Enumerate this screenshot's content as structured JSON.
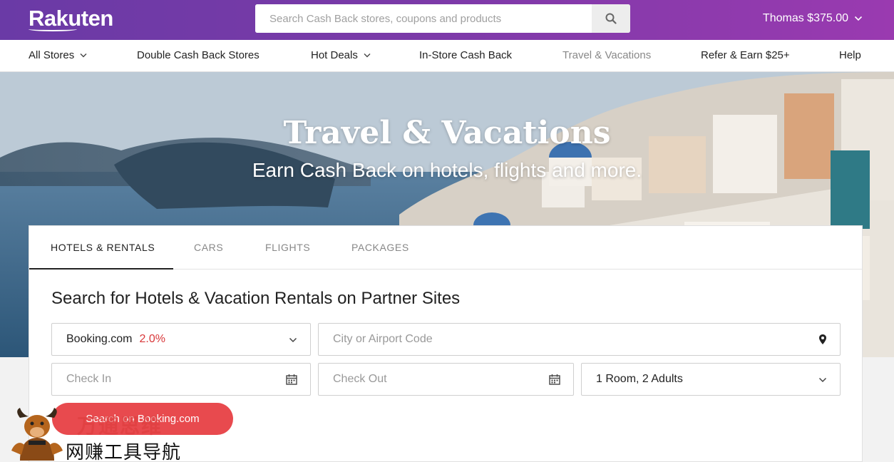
{
  "brand": {
    "logo_text": "Rakuten",
    "accent": "#7b3aa9",
    "cta_color": "#e84a4e",
    "rate_color": "#d9383a"
  },
  "header": {
    "search_placeholder": "Search Cash Back stores, coupons and products",
    "search_icon": "search-icon",
    "user_label": "Thomas $375.00"
  },
  "nav": {
    "items": [
      {
        "label": "All Stores",
        "has_dropdown": true
      },
      {
        "label": "Double Cash Back Stores",
        "has_dropdown": false
      },
      {
        "label": "Hot Deals",
        "has_dropdown": true
      },
      {
        "label": "In-Store Cash Back",
        "has_dropdown": false
      },
      {
        "label": "Travel & Vacations",
        "has_dropdown": false,
        "active": true
      },
      {
        "label": "Refer & Earn $25+",
        "has_dropdown": false
      },
      {
        "label": "Help",
        "has_dropdown": false
      }
    ]
  },
  "hero": {
    "title": "Travel & Vacations",
    "subtitle": "Earn Cash Back on hotels, flights and more."
  },
  "search_card": {
    "tabs": [
      {
        "label": "HOTELS & RENTALS",
        "active": true
      },
      {
        "label": "CARS",
        "active": false
      },
      {
        "label": "FLIGHTS",
        "active": false
      },
      {
        "label": "PACKAGES",
        "active": false
      }
    ],
    "title": "Search for Hotels & Vacation Rentals on Partner Sites",
    "partner": {
      "value": "Booking.com",
      "rate": "2.0%"
    },
    "location_placeholder": "City or Airport Code",
    "checkin_placeholder": "Check In",
    "checkout_placeholder": "Check Out",
    "guests_value": "1 Room, 2 Adults",
    "submit_label": "Search on Booking.com"
  },
  "watermark": {
    "line1": "万通思维",
    "line2": "网赚工具导航"
  }
}
